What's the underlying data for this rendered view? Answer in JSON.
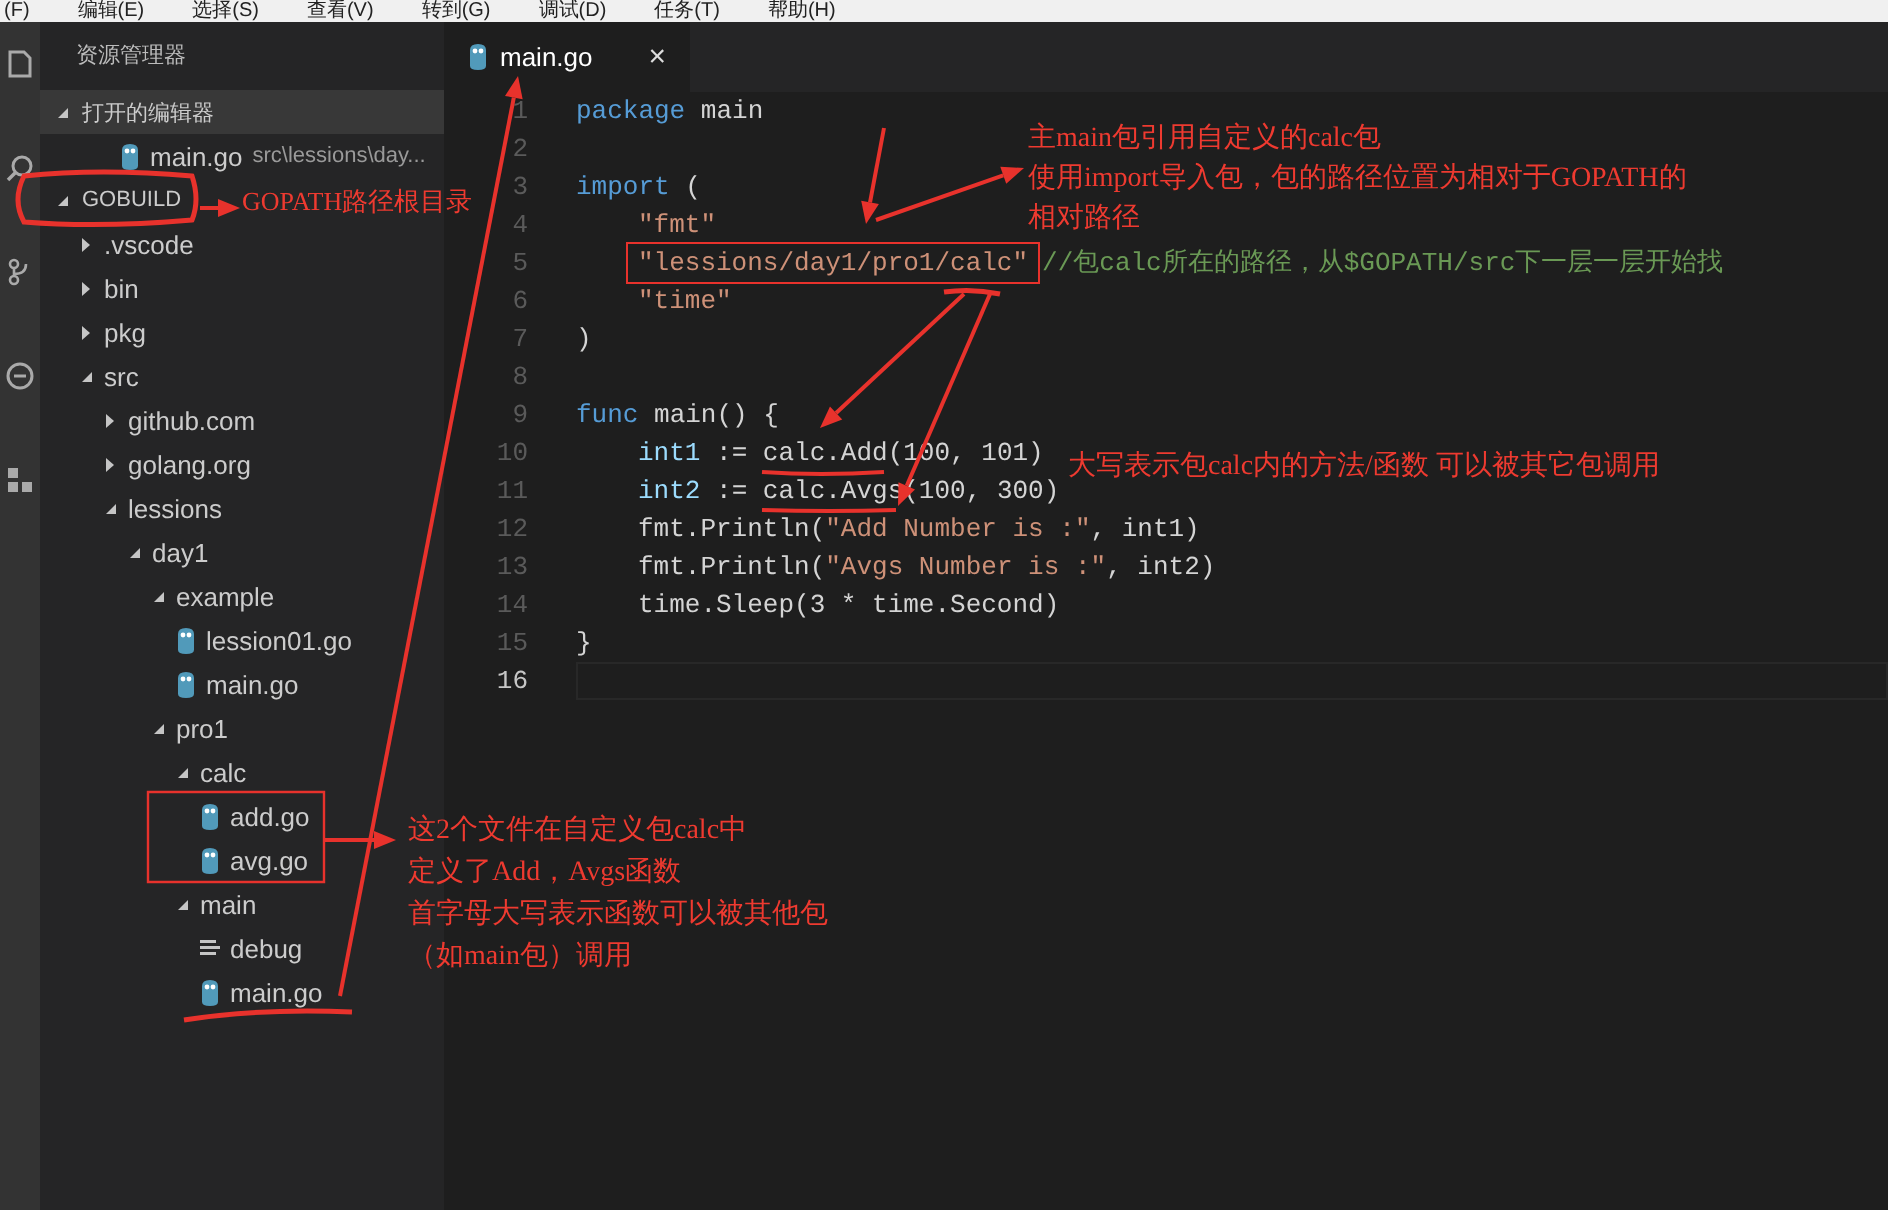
{
  "menu_bar": {
    "items": [
      "(F)",
      "编辑(E)",
      "选择(S)",
      "查看(V)",
      "转到(G)",
      "调试(D)",
      "任务(T)",
      "帮助(H)"
    ]
  },
  "sidebar": {
    "title": "资源管理器",
    "open_editors": {
      "title": "打开的编辑器",
      "expanded": true,
      "items": [
        {
          "name": "main.go",
          "path": "src\\lessions\\day...",
          "kind": "go"
        }
      ]
    },
    "folder": {
      "title": "GOBUILD",
      "expanded": true,
      "children": [
        {
          "name": ".vscode",
          "kind": "folder",
          "expanded": false
        },
        {
          "name": "bin",
          "kind": "folder",
          "expanded": false
        },
        {
          "name": "pkg",
          "kind": "folder",
          "expanded": false
        },
        {
          "name": "src",
          "kind": "folder",
          "expanded": true,
          "children": [
            {
              "name": "github.com",
              "kind": "folder",
              "expanded": false
            },
            {
              "name": "golang.org",
              "kind": "folder",
              "expanded": false
            },
            {
              "name": "lessions",
              "kind": "folder",
              "expanded": true,
              "children": [
                {
                  "name": "day1",
                  "kind": "folder",
                  "expanded": true,
                  "children": [
                    {
                      "name": "example",
                      "kind": "folder",
                      "expanded": true,
                      "children": [
                        {
                          "name": "lession01.go",
                          "kind": "go"
                        },
                        {
                          "name": "main.go",
                          "kind": "go"
                        }
                      ]
                    },
                    {
                      "name": "pro1",
                      "kind": "folder",
                      "expanded": true,
                      "children": [
                        {
                          "name": "calc",
                          "kind": "folder",
                          "expanded": true,
                          "children": [
                            {
                              "name": "add.go",
                              "kind": "go"
                            },
                            {
                              "name": "avg.go",
                              "kind": "go"
                            }
                          ]
                        },
                        {
                          "name": "main",
                          "kind": "folder",
                          "expanded": true,
                          "children": [
                            {
                              "name": "debug",
                              "kind": "binary"
                            },
                            {
                              "name": "main.go",
                              "kind": "go"
                            }
                          ]
                        }
                      ]
                    }
                  ]
                }
              ]
            }
          ]
        }
      ]
    }
  },
  "editor": {
    "tabs": [
      {
        "label": "main.go",
        "selected": true,
        "close": "×"
      }
    ],
    "lines": [
      {
        "number": "1",
        "current": false,
        "indented": false,
        "tokens": [
          {
            "kind": "keyword",
            "text": "package"
          },
          {
            "kind": "plain",
            "text": " main"
          }
        ]
      },
      {
        "number": "2",
        "current": false
      },
      {
        "number": "3",
        "current": false,
        "indented": false,
        "tokens": [
          {
            "kind": "keyword",
            "text": "import"
          },
          {
            "kind": "plain",
            "text": " ("
          }
        ]
      },
      {
        "number": "4",
        "current": false,
        "indented": true,
        "tokens": [
          {
            "kind": "string",
            "text": "\"fmt\""
          }
        ]
      },
      {
        "number": "5",
        "current": false,
        "indented": true,
        "tokens": [
          {
            "kind": "string",
            "text": "\"lessions/day1/pro1/calc\"",
            "boxed": true
          },
          {
            "kind": "comment",
            "text": "//包calc所在的路径，从$GOPATH/src下一层一层开始找",
            "boxed": false
          }
        ]
      },
      {
        "number": "6",
        "current": false,
        "indented": true,
        "tokens": [
          {
            "kind": "string",
            "text": "\"time\""
          }
        ]
      },
      {
        "number": "7",
        "current": false,
        "indented": false,
        "tokens": [
          {
            "kind": "plain",
            "text": ")"
          }
        ]
      },
      {
        "number": "8",
        "current": false
      },
      {
        "number": "9",
        "current": false,
        "indented": false,
        "tokens": [
          {
            "kind": "keyword",
            "text": "func"
          },
          {
            "kind": "plain",
            "text": " main() {"
          }
        ]
      },
      {
        "number": "10",
        "current": false,
        "indented": true,
        "tokens": [
          {
            "kind": "variable",
            "text": "int1"
          },
          {
            "kind": "plain",
            "text": " := calc.Add(100, 101)"
          }
        ]
      },
      {
        "number": "11",
        "current": false,
        "indented": true,
        "tokens": [
          {
            "kind": "variable",
            "text": "int2"
          },
          {
            "kind": "plain",
            "text": " := calc.Avgs(100, 300)"
          }
        ]
      },
      {
        "number": "12",
        "current": false,
        "indented": true,
        "tokens": [
          {
            "kind": "plain",
            "text": "fmt.Println("
          },
          {
            "kind": "string",
            "text": "\"Add Number is :\""
          },
          {
            "kind": "plain",
            "text": ", int1)"
          }
        ]
      },
      {
        "number": "13",
        "current": false,
        "indented": true,
        "tokens": [
          {
            "kind": "plain",
            "text": "fmt.Println("
          },
          {
            "kind": "string",
            "text": "\"Avgs Number is :\""
          },
          {
            "kind": "plain",
            "text": ", int2)"
          }
        ]
      },
      {
        "number": "14",
        "current": false,
        "indented": true,
        "tokens": [
          {
            "kind": "plain",
            "text": "time.Sleep(3 * time.Second)"
          }
        ]
      },
      {
        "number": "15",
        "current": false,
        "indented": false,
        "tokens": [
          {
            "kind": "plain",
            "text": "}"
          }
        ]
      },
      {
        "number": "16",
        "current": true
      }
    ]
  },
  "annotations": {
    "gopath_note": "GOPATH路径根目录",
    "import_note": [
      "主main包引用自定义的calc包",
      "使用import导入包，包的路径位置为相对于GOPATH的",
      "相对路径"
    ],
    "export_note": "大写表示包calc内的方法/函数 可以被其它包调用",
    "calc_note": [
      "这2个文件在自定义包calc中",
      "定义了Add，Avgs函数",
      "首字母大写表示函数可以被其他包",
      "（如main包）调用"
    ]
  }
}
